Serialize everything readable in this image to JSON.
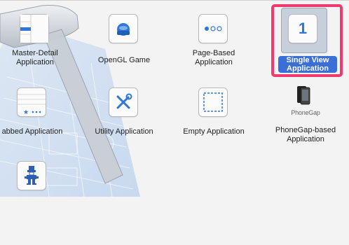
{
  "templates": [
    {
      "name": [
        "Master-Detail",
        "Application"
      ],
      "icon": "master-detail-icon"
    },
    {
      "name": [
        "OpenGL Game"
      ],
      "icon": "opengl-game-icon"
    },
    {
      "name": [
        "Page-Based",
        "Application"
      ],
      "icon": "page-based-icon"
    },
    {
      "name": [
        "Single View",
        "Application"
      ],
      "icon": "single-view-icon",
      "selected": true,
      "icon_text": "1"
    },
    {
      "name": [
        "abbed Application"
      ],
      "icon": "tabbed-icon"
    },
    {
      "name": [
        "Utility Application"
      ],
      "icon": "utility-icon"
    },
    {
      "name": [
        "Empty Application"
      ],
      "icon": "empty-icon"
    },
    {
      "name": [
        "PhoneGap-based",
        "Application"
      ],
      "icon": "phonegap-icon",
      "icon_text": "PhoneGap"
    },
    {
      "name": [],
      "icon": "cocos2d-icon"
    }
  ],
  "colors": {
    "selection_frame": "#f0396d",
    "selected_label_bg": "#3b6fd8",
    "accent_blue": "#2f76d8"
  }
}
